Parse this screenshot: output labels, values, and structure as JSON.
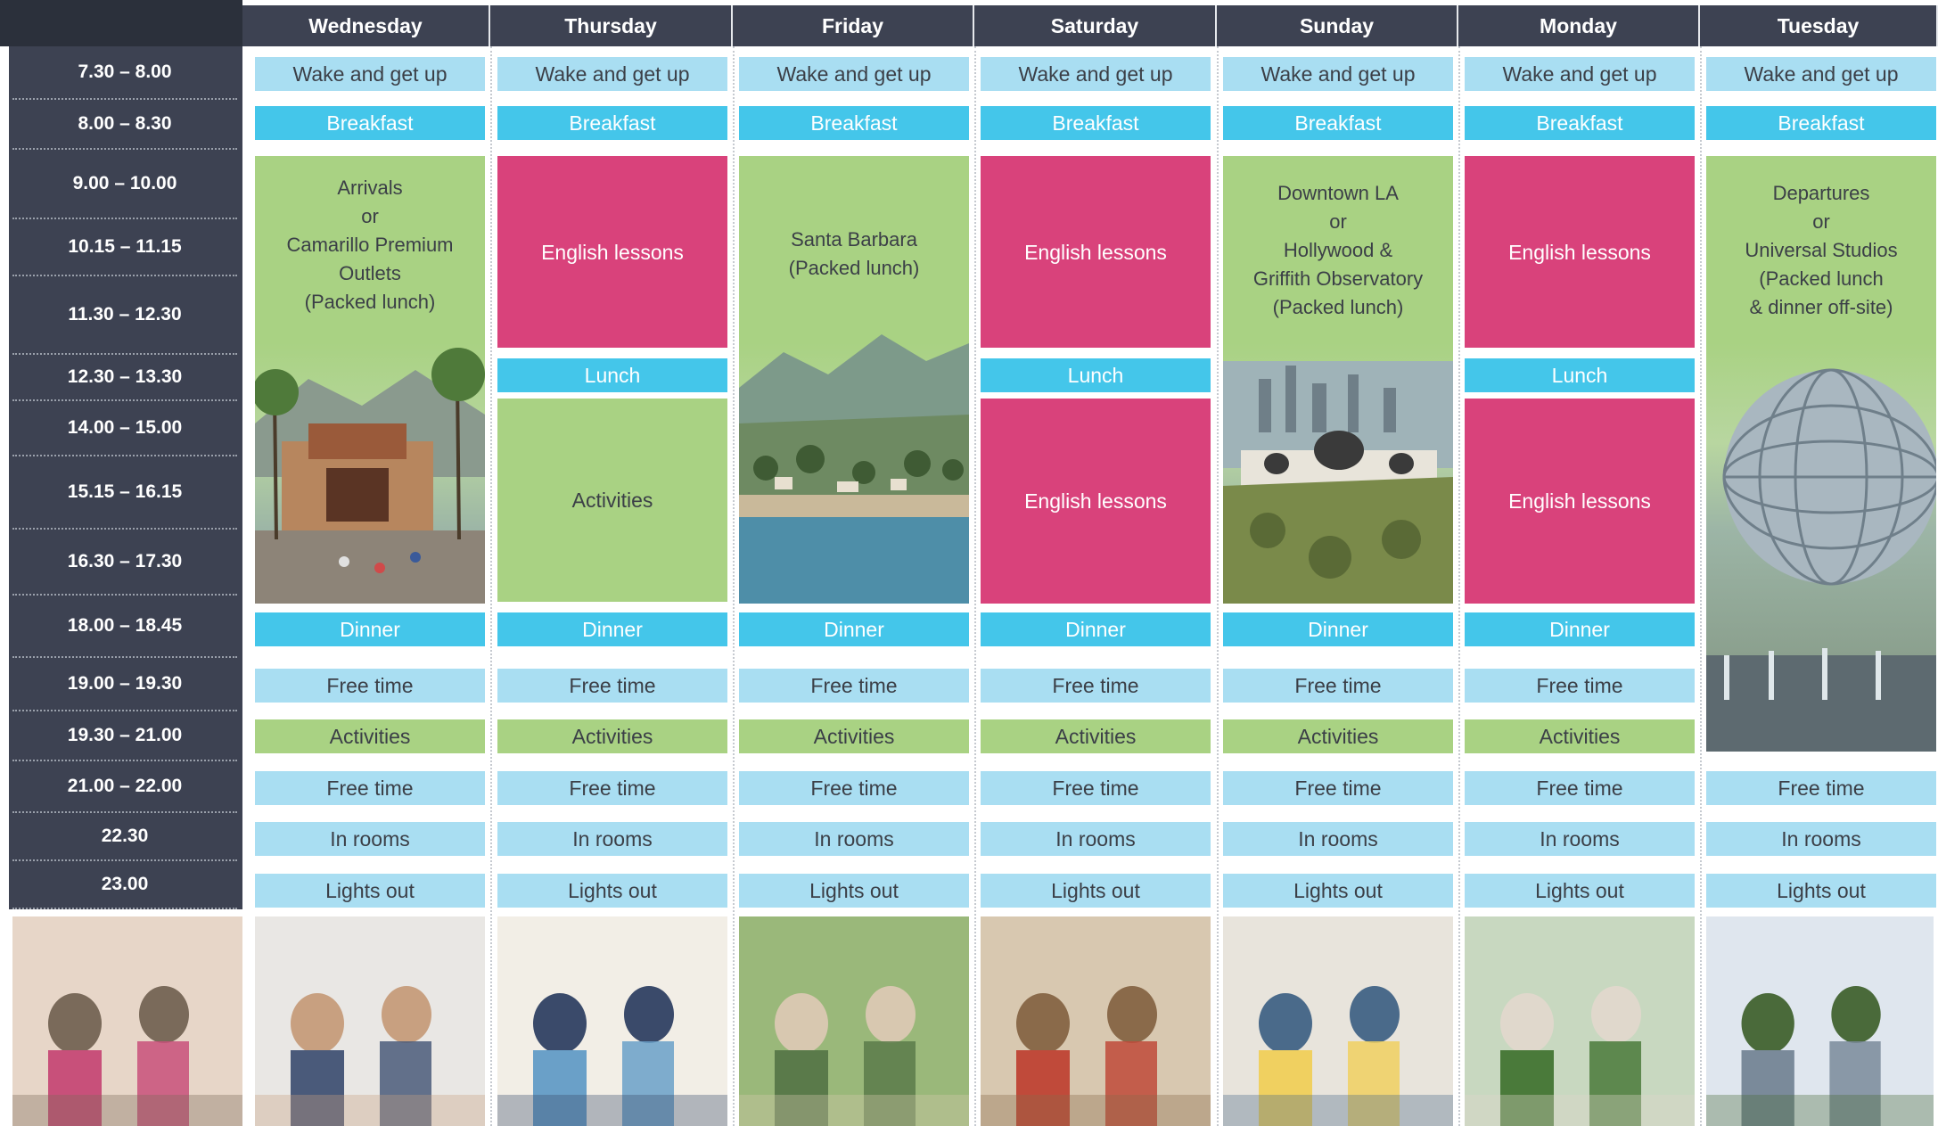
{
  "days": [
    "Wednesday",
    "Thursday",
    "Friday",
    "Saturday",
    "Sunday",
    "Monday",
    "Tuesday"
  ],
  "times": [
    "7.30 – 8.00",
    "8.00 – 8.30",
    "9.00 – 10.00",
    "10.15 – 11.15",
    "11.30 – 12.30",
    "12.30 – 13.30",
    "14.00 – 15.00",
    "15.15 – 16.15",
    "16.30 – 17.30",
    "18.00 – 18.45",
    "19.00 – 19.30",
    "19.30 – 21.00",
    "21.00 – 22.00",
    "22.30",
    "23.00"
  ],
  "labels": {
    "wake": "Wake and get up",
    "breakfast": "Breakfast",
    "english": "English lessons",
    "lunch": "Lunch",
    "activities": "Activities",
    "dinner": "Dinner",
    "free_time": "Free time",
    "in_rooms": "In rooms",
    "lights_out": "Lights out"
  },
  "trips": {
    "wednesday": [
      "Arrivals",
      "or",
      "Camarillo Premium",
      "Outlets",
      "(Packed lunch)"
    ],
    "friday": [
      "Santa Barbara",
      "(Packed lunch)"
    ],
    "sunday": [
      "Downtown LA",
      "or",
      "Hollywood &",
      "Griffith Observatory",
      "(Packed lunch)"
    ],
    "tuesday": [
      "Departures",
      "or",
      "Universal Studios",
      "(Packed lunch",
      "& dinner off-site)"
    ]
  },
  "colors": {
    "header": "#3d4252",
    "light_blue": "#a9def2",
    "cyan": "#44c6ea",
    "pink": "#d9427b",
    "green": "#a9d283"
  }
}
